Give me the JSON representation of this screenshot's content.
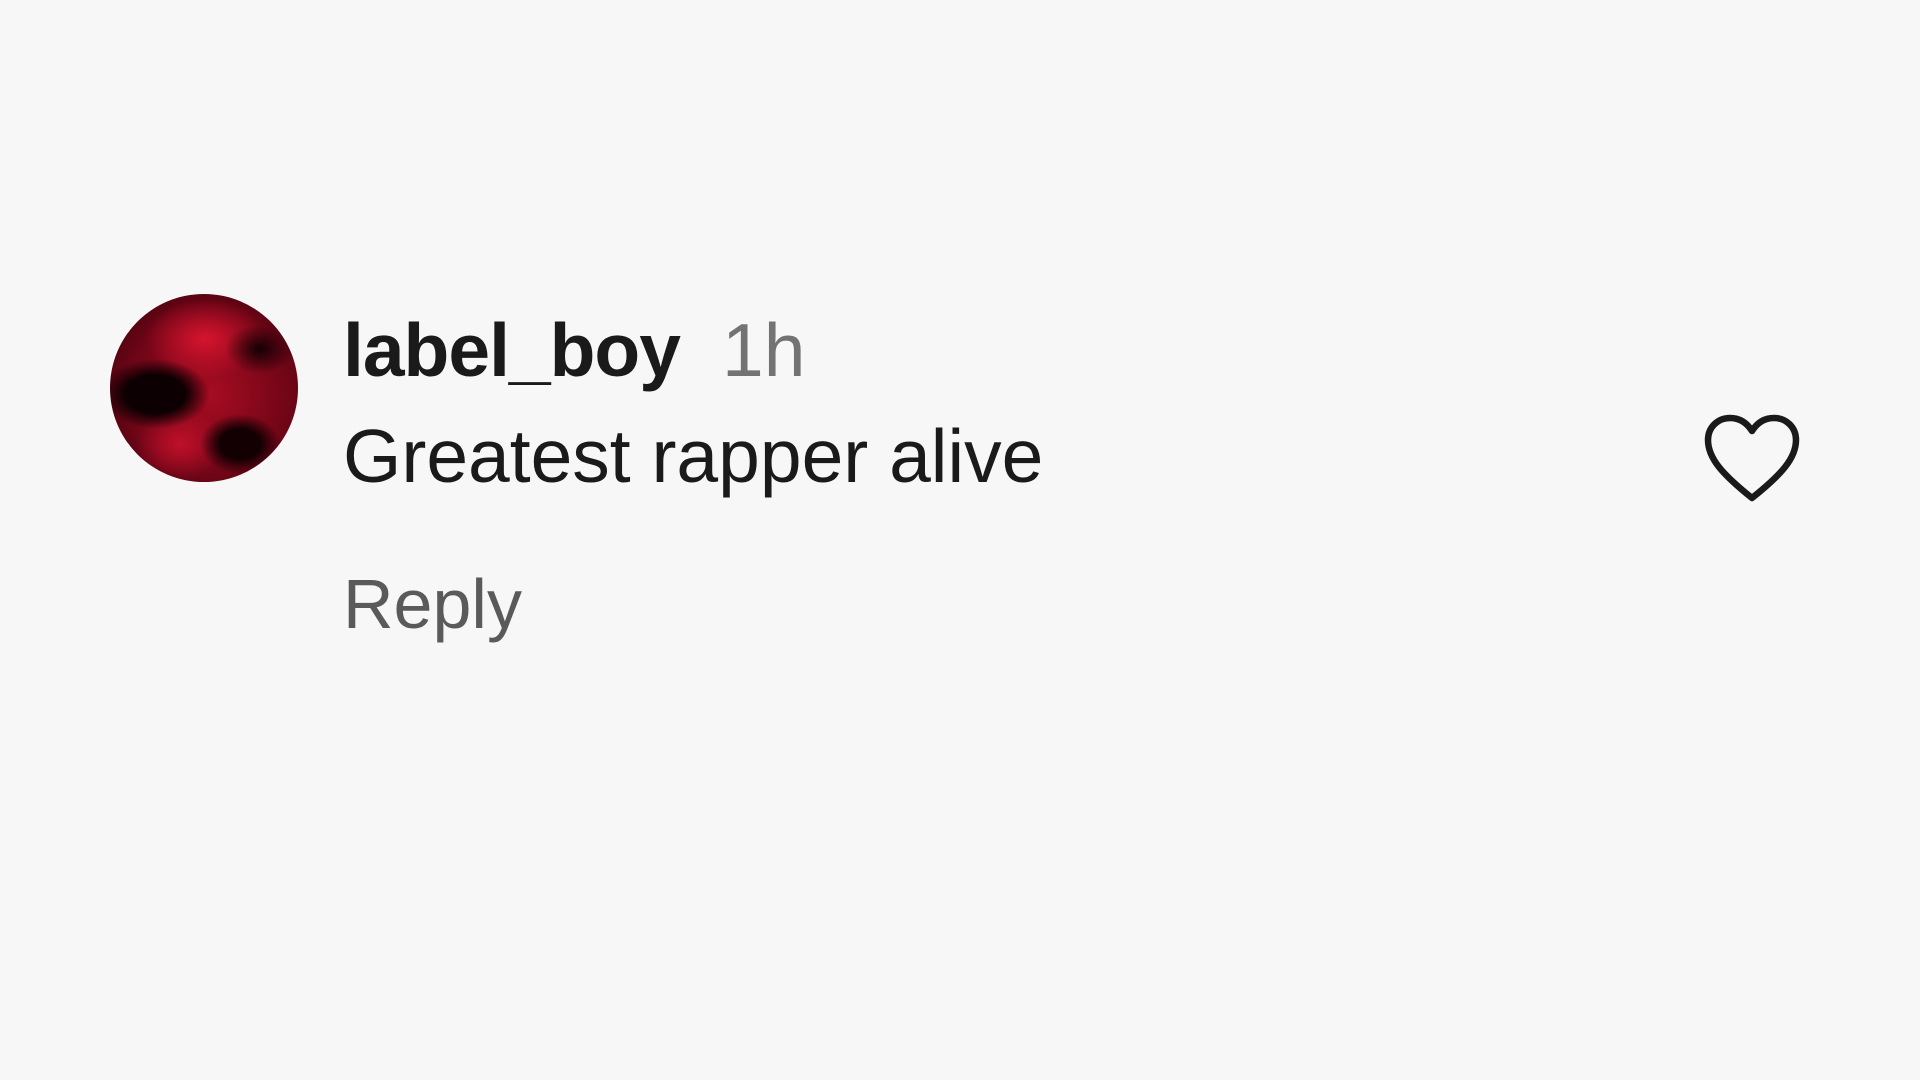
{
  "comment": {
    "username": "label_boy",
    "timestamp": "1h",
    "text": "Greatest rapper alive",
    "reply_label": "Reply",
    "like_icon": "heart-outline-icon",
    "avatar_icon": "profile-photo"
  },
  "colors": {
    "background": "#f7f7f7",
    "primary_text": "#1a1a1a",
    "secondary_text": "#737373",
    "reply_text": "#5a5a5a",
    "avatar_accent": "#a80c22"
  }
}
